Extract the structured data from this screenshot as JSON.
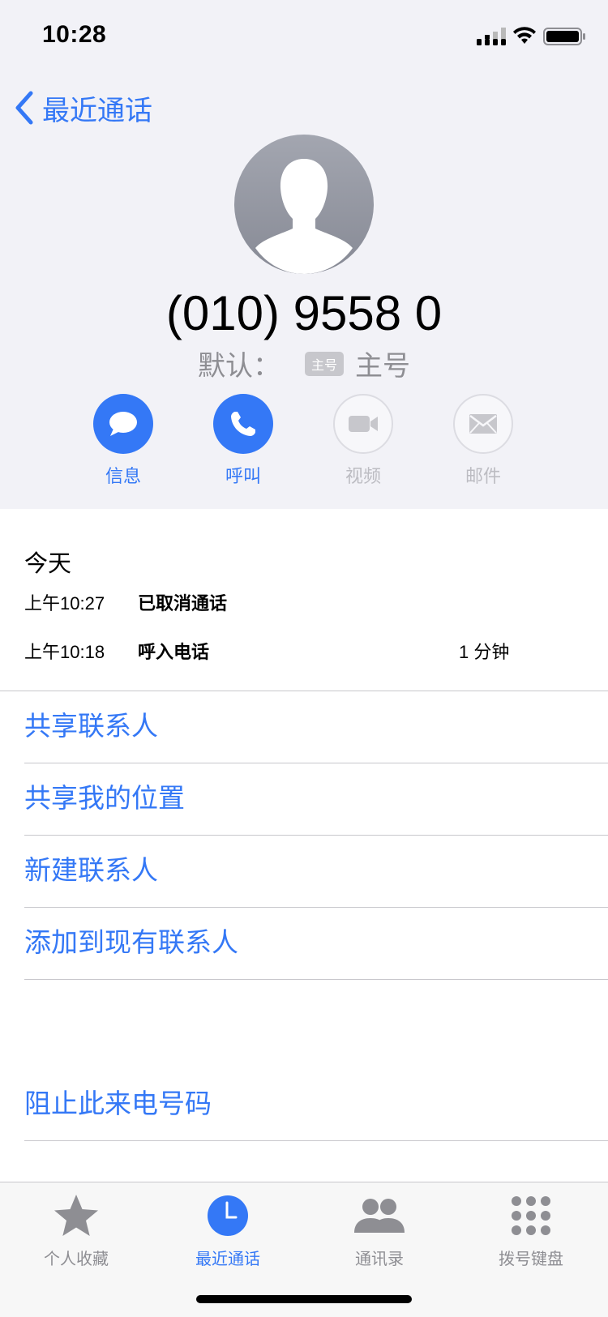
{
  "status_bar": {
    "time": "10:28"
  },
  "nav": {
    "back_label": "最近通话"
  },
  "contact": {
    "number": "(010) 9558 0",
    "label_prefix": "默认：",
    "tag": "主号",
    "label": "主号"
  },
  "actions": [
    {
      "label": "信息",
      "icon": "message-icon",
      "enabled": true
    },
    {
      "label": "呼叫",
      "icon": "phone-icon",
      "enabled": true
    },
    {
      "label": "视频",
      "icon": "video-icon",
      "enabled": false
    },
    {
      "label": "邮件",
      "icon": "mail-icon",
      "enabled": false
    }
  ],
  "history": {
    "day": "今天",
    "calls": [
      {
        "time": "上午10:27",
        "type": "已取消通话",
        "duration": ""
      },
      {
        "time": "上午10:18",
        "type": "呼入电话",
        "duration": "1 分钟"
      }
    ]
  },
  "options": {
    "share_contact": "共享联系人",
    "share_location": "共享我的位置",
    "new_contact": "新建联系人",
    "add_to_existing": "添加到现有联系人",
    "block": "阻止此来电号码"
  },
  "tabbar": {
    "tabs": [
      {
        "label": "个人收藏",
        "icon": "star-icon",
        "active": false
      },
      {
        "label": "最近通话",
        "icon": "clock-icon",
        "active": true
      },
      {
        "label": "通讯录",
        "icon": "contacts-icon",
        "active": false
      },
      {
        "label": "拨号键盘",
        "icon": "keypad-icon",
        "active": false
      }
    ]
  },
  "colors": {
    "accent": "#3478f6",
    "inactive": "#8e8e93",
    "background": "#f2f2f7"
  }
}
